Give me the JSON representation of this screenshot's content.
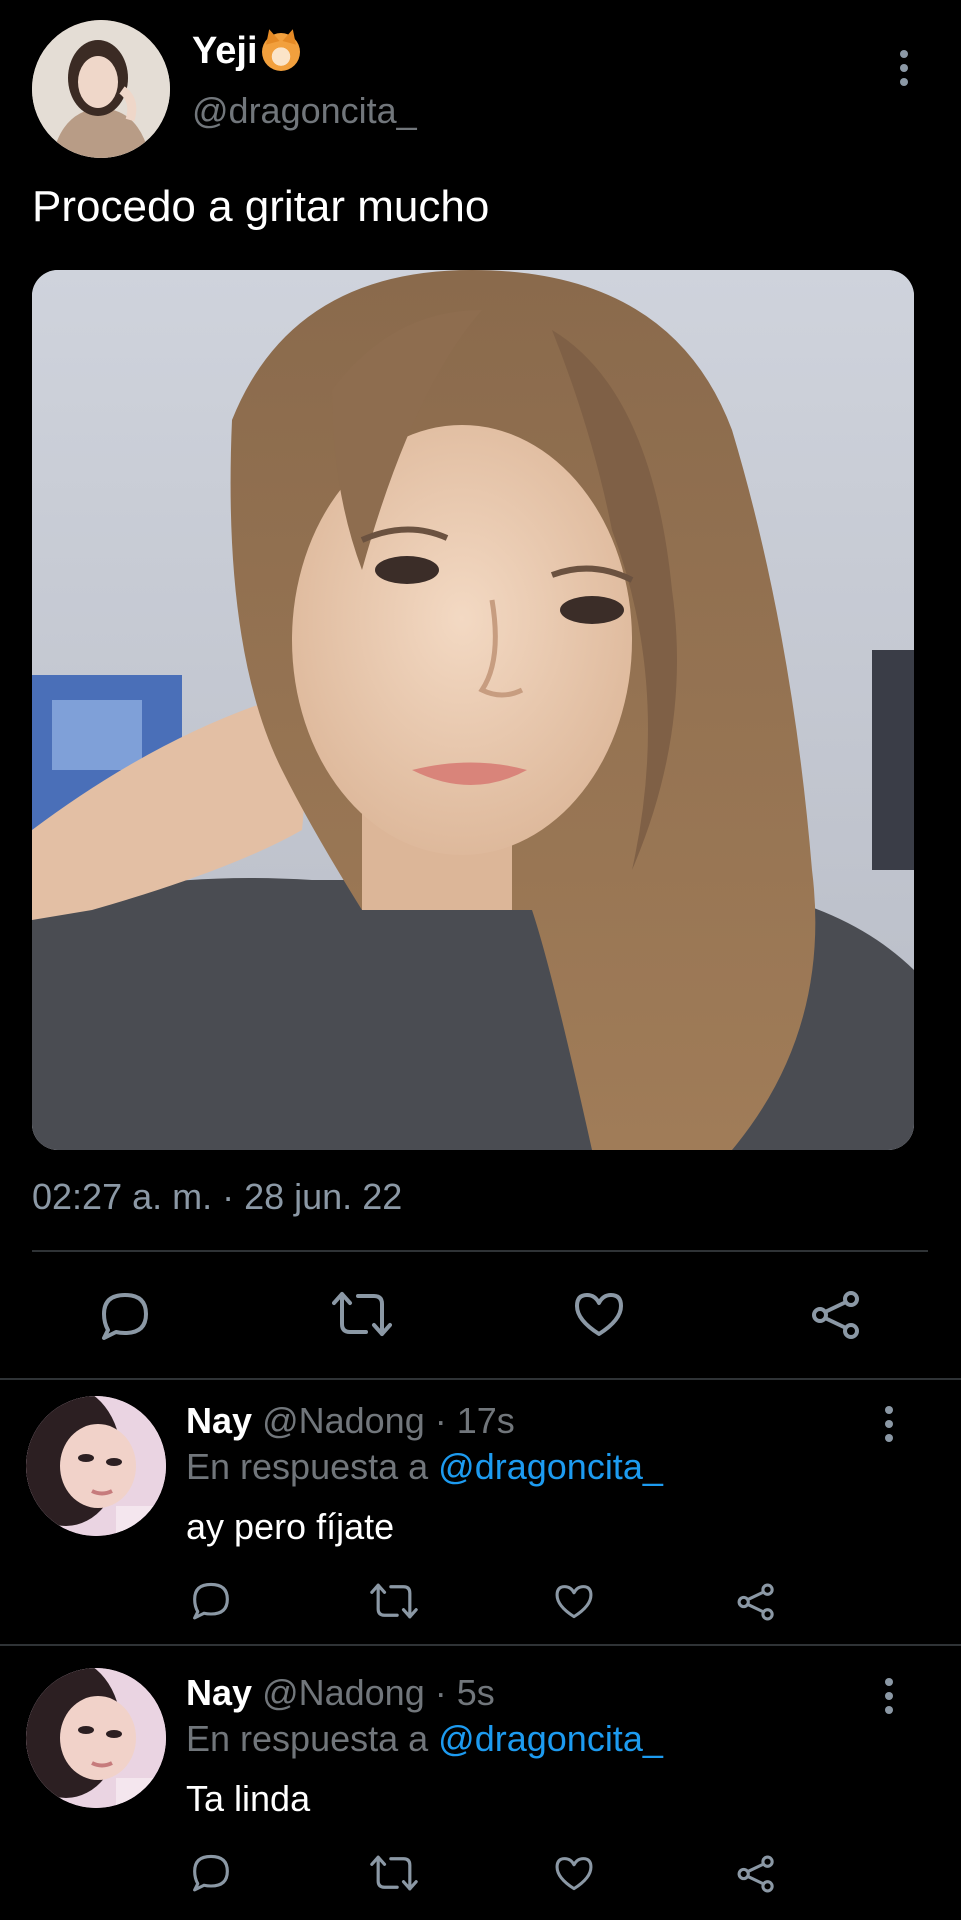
{
  "tweet": {
    "author_name": "Yeji",
    "author_emoji": "dog-face-emoji",
    "author_handle": "@dragoncita_",
    "text": "Procedo a gritar mucho",
    "timestamp": "02:27 a. m. · 28 jun. 22",
    "actions": [
      "reply-icon",
      "retweet-icon",
      "like-icon",
      "share-icon"
    ]
  },
  "replies": [
    {
      "name": "Nay",
      "meta": "@Nadong · 17s",
      "reply_prefix": "En respuesta a",
      "reply_mention": "@dragoncita_",
      "text": "ay pero fíjate"
    },
    {
      "name": "Nay",
      "meta": "@Nadong · 5s",
      "reply_prefix": "En respuesta a",
      "reply_mention": "@dragoncita_",
      "text": "Ta linda"
    }
  ],
  "colors": {
    "background": "#000000",
    "text_primary": "#ffffff",
    "text_secondary": "#71767b",
    "link": "#1d9bf0",
    "divider": "#2f3336"
  }
}
